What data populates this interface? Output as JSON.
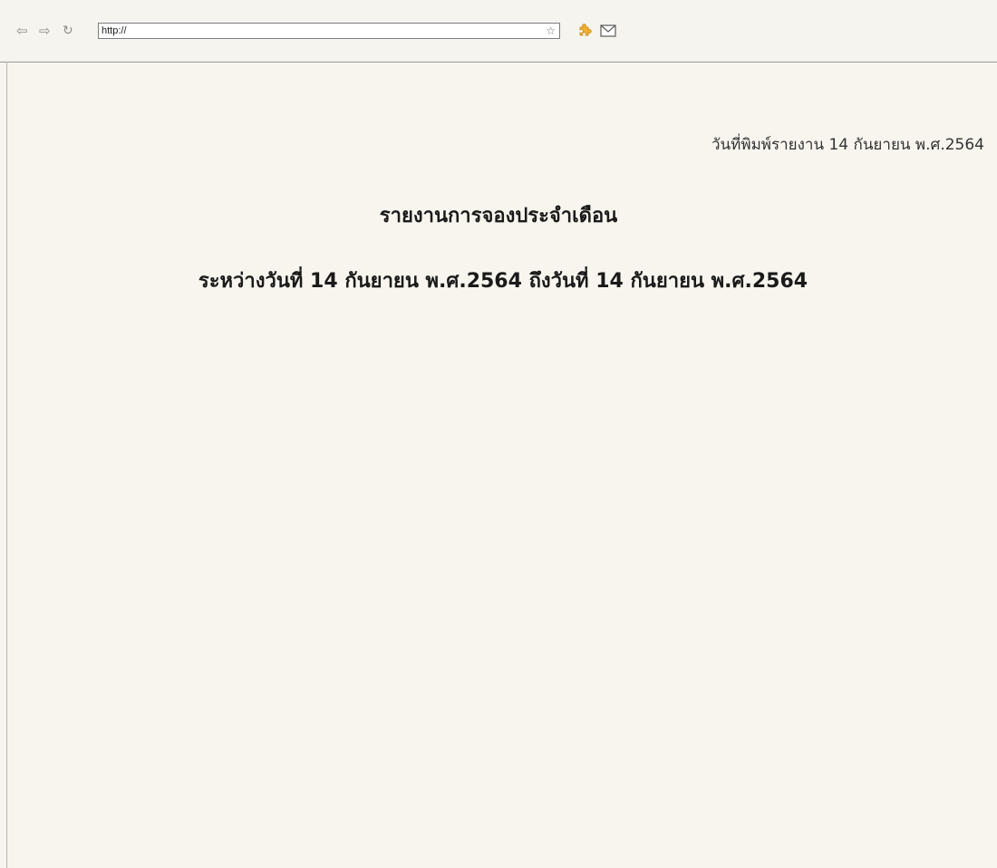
{
  "browser": {
    "nav": {
      "back_glyph": "⇦",
      "forward_glyph": "⇨",
      "reload_glyph": "↻"
    },
    "url": "http://",
    "icons": {
      "bookmark": "star-icon",
      "addon": "puzzle-addon-icon",
      "mail": "mail-icon"
    },
    "colors": {
      "chrome_bg": "#f6f4ee",
      "page_bg": "#f8f5ee",
      "addon_accent": "#f0b030"
    }
  },
  "report": {
    "print_date": "วันที่พิมพ์รายงาน 14 กันยายน พ.ศ.2564",
    "title": "รายงานการจองประจำเดือน",
    "range": "ระหว่างวันที่ 14 กันยายน พ.ศ.2564 ถึงวันที่ 14 กันยายน พ.ศ.2564"
  }
}
